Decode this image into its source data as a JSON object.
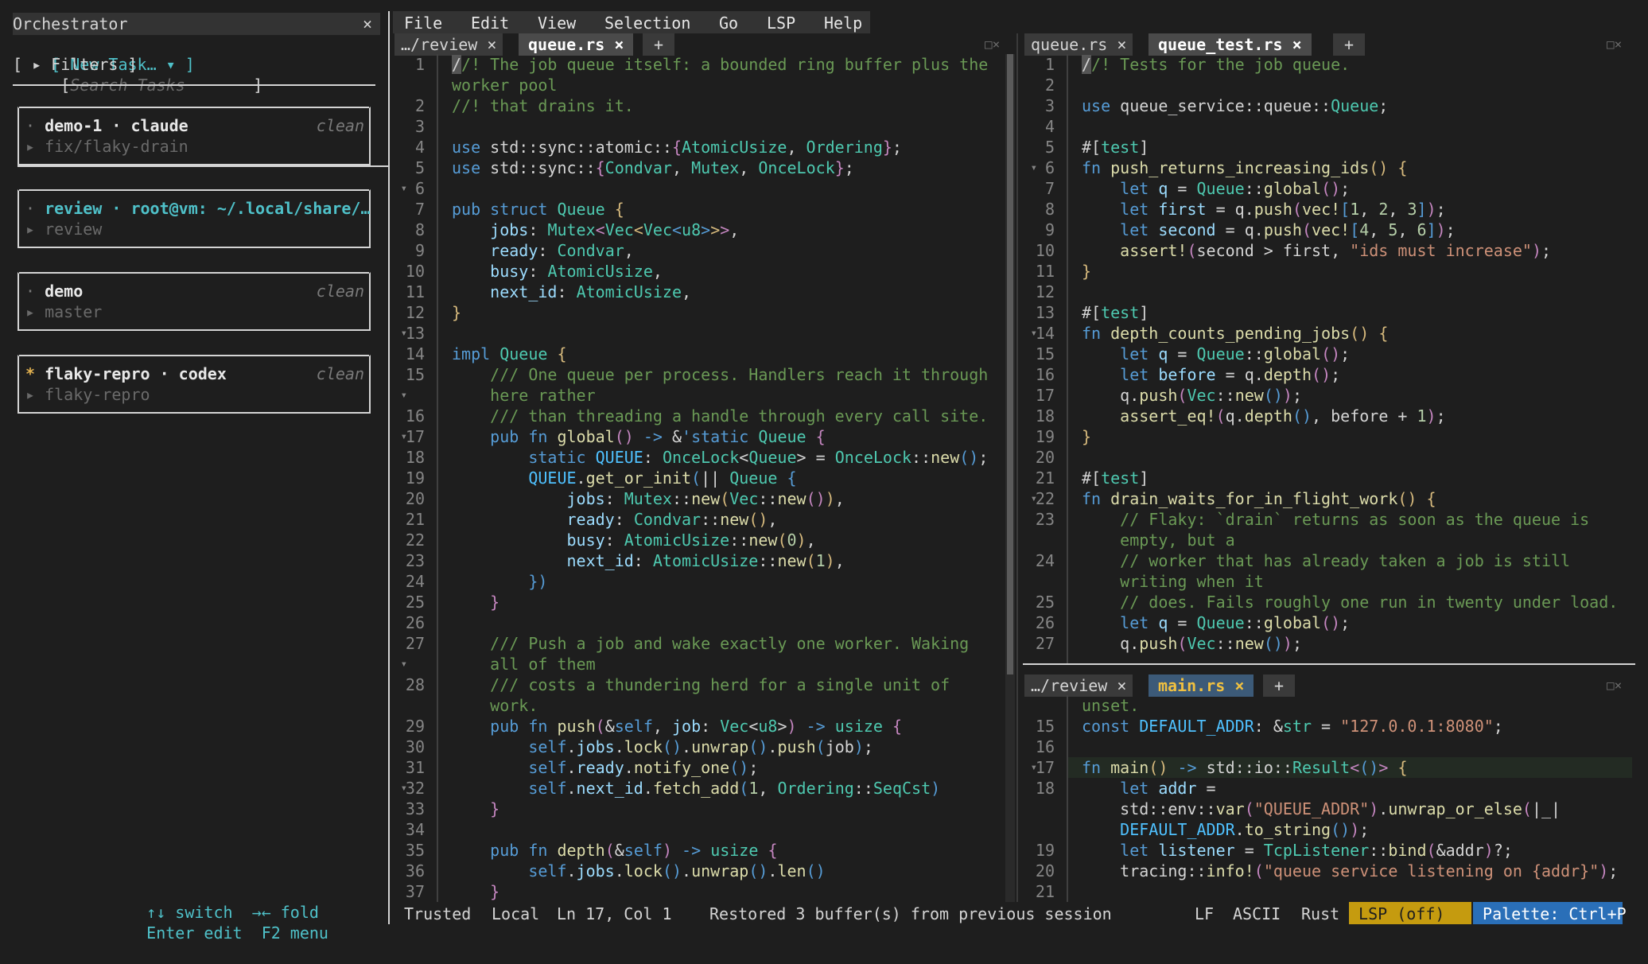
{
  "sidebar": {
    "title": "Orchestrator",
    "close": "×",
    "new_task": "[ New Task… ▾ ]",
    "search_placeholder": "Search Tasks",
    "filters": "[ ▸ Filters ]",
    "tasks": [
      {
        "marker": "·",
        "name": "demo-1 · claude",
        "status": "clean",
        "branch": "▸ fix/flaky-drain"
      },
      {
        "marker": "·",
        "name": "review · root@vm: ~/.local/share/…",
        "status": "",
        "branch": "▸ review"
      },
      {
        "marker": "·",
        "name": "demo",
        "status": "clean",
        "branch": "▸ master"
      },
      {
        "marker": "*",
        "name": "flaky-repro · codex",
        "status": "clean",
        "branch": "▸ flaky-repro"
      }
    ],
    "hints": {
      "switch": "↑↓ switch",
      "fold": "→← fold",
      "edit": "Enter edit",
      "menu": "F2 menu"
    }
  },
  "menu": [
    "File",
    "Edit",
    "View",
    "Selection",
    "Go",
    "LSP",
    "Help"
  ],
  "left_pane": {
    "tabs": [
      {
        "label": "…/review ×",
        "active": false
      },
      {
        "label": "queue.rs ×",
        "active": true
      },
      {
        "label": "+",
        "active": false
      }
    ],
    "win_controls": "□×"
  },
  "right_top_pane": {
    "tabs": [
      {
        "label": "queue.rs ×",
        "active": false
      },
      {
        "label": "queue_test.rs ×",
        "active": true
      },
      {
        "label": "+",
        "active": false
      }
    ],
    "win_controls": "□×"
  },
  "right_bottom_pane": {
    "tabs": [
      {
        "label": "…/review ×",
        "active": false
      },
      {
        "label": "main.rs ×",
        "active": true
      },
      {
        "label": "+",
        "active": false
      }
    ],
    "win_controls": "□×"
  },
  "status": {
    "trusted": "Trusted",
    "local": "Local",
    "position": "Ln 17, Col 1",
    "message": "Restored 3 buffer(s) from previous session",
    "eol": "LF",
    "encoding": "ASCII",
    "language": "Rust",
    "lsp": " LSP (off) ",
    "palette": " Palette: Ctrl+P"
  },
  "colors": {
    "accent": "#4fc1c9",
    "lsp_bg": "#c59b0f",
    "palette_bg": "#2a6fb8"
  }
}
